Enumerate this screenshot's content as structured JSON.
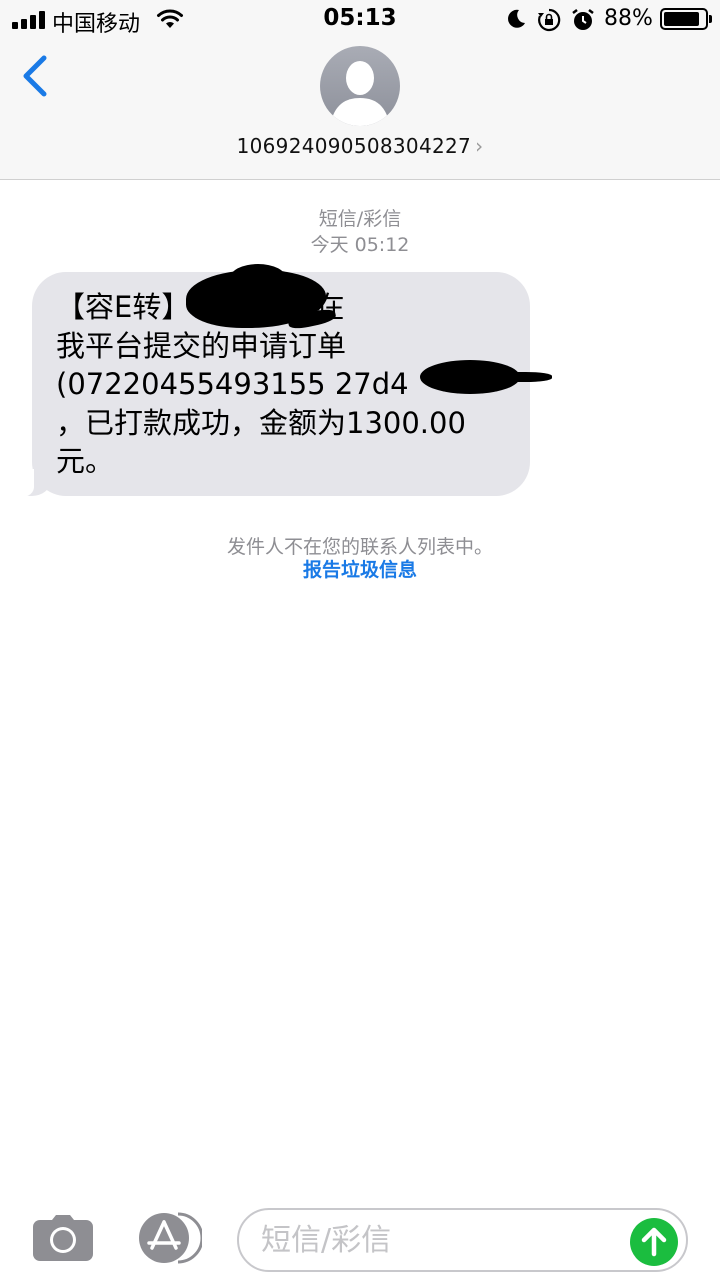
{
  "status_bar": {
    "carrier": "中国移动",
    "time": "05:13",
    "battery_percent": "88%",
    "battery_level": 0.88
  },
  "nav": {
    "contact_number": "106924090508304227",
    "chevron": "›"
  },
  "conversation": {
    "message_type": "短信/彩信",
    "timestamp": "今天 05:12",
    "message": {
      "lines": [
        "【容E转】                     您好，您在",
        "我平台提交的申请订单",
        "(07220455493155 27d4",
        "，已打款成功，金额为1300.00",
        "元。"
      ]
    },
    "notice": "发件人不在您的联系人列表中。",
    "report_link": "报告垃圾信息"
  },
  "input_bar": {
    "placeholder": "短信/彩信"
  },
  "colors": {
    "bubble": "#e5e5ea",
    "link_blue": "#1a7ae6",
    "send_green": "#1bbd3f",
    "meta_gray": "#8e8e93"
  },
  "icons": [
    "signal-icon",
    "wifi-icon",
    "moon-icon",
    "rotation-lock-icon",
    "alarm-icon",
    "battery-icon",
    "back-chevron-icon",
    "contact-avatar-icon",
    "camera-icon",
    "app-store-icon",
    "send-arrow-icon"
  ]
}
